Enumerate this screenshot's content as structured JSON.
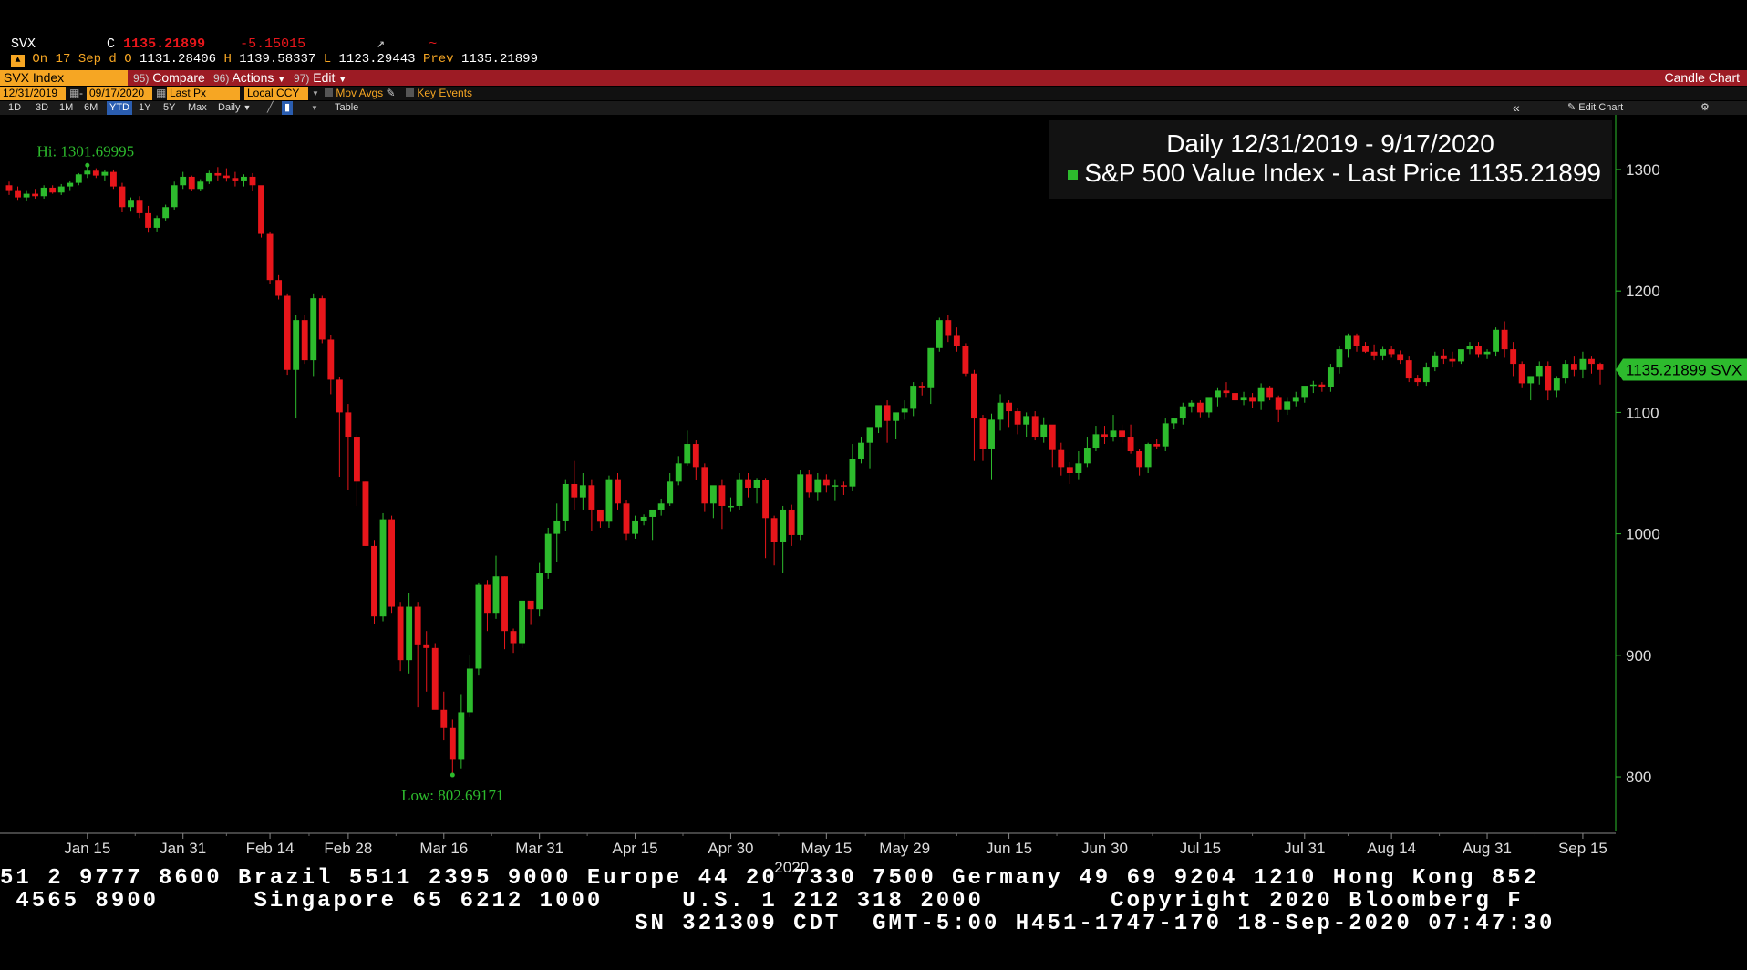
{
  "header": {
    "symbol": "SVX",
    "close_label": "C",
    "close_value": "1135.21899",
    "change": "-5.15015",
    "on_label": "On 17 Sep d",
    "open_label": "O",
    "open_value": "1131.28406",
    "high_label": "H",
    "high_value": "1139.58337",
    "low_label": "L",
    "low_value": "1123.29443",
    "prev_label": "Prev",
    "prev_value": "1135.21899"
  },
  "toolbar": {
    "security": "SVX Index",
    "compare_num": "95)",
    "compare": "Compare",
    "actions_num": "96)",
    "actions": "Actions",
    "edit_num": "97)",
    "edit": "Edit",
    "chart_type": "Candle Chart"
  },
  "options": {
    "start_date": "12/31/2019",
    "end_date": "09/17/2020",
    "field": "Last Px",
    "currency": "Local CCY",
    "mov_avgs": "Mov Avgs",
    "key_events": "Key Events"
  },
  "timeframes": [
    "1D",
    "3D",
    "1M",
    "6M",
    "YTD",
    "1Y",
    "5Y",
    "Max"
  ],
  "timeframe_selected": "YTD",
  "period": "Daily",
  "table_label": "Table",
  "edit_chart_label": "Edit Chart",
  "colors": {
    "up": "#2dbb2d",
    "down": "#e8161b",
    "accent": "#f6a623",
    "bar": "#9c1b24"
  },
  "chart_data": {
    "type": "candlestick",
    "title": "Daily 12/31/2019 - 9/17/2020",
    "series_name": "S&P 500 Value Index - Last Price",
    "last_price": "1135.21899",
    "last_price_tag": "1135.21899 SVX",
    "hi_label": "Hi: 1301.69995",
    "low_label": "Low: 802.69171",
    "ylim": [
      755,
      1345
    ],
    "y_ticks": [
      800,
      900,
      1000,
      1100,
      1200,
      1300
    ],
    "x_tick_labels": [
      "Jan 15",
      "Jan 31",
      "Feb 14",
      "Feb 28",
      "Mar 16",
      "Mar 31",
      "Apr 15",
      "Apr 30",
      "May 15",
      "May 29",
      "Jun 15",
      "Jun 30",
      "Jul 15",
      "Jul 31",
      "Aug 14",
      "Aug 31",
      "Sep 15"
    ],
    "x_tick_index": [
      9,
      20,
      30,
      39,
      50,
      61,
      72,
      83,
      94,
      103,
      115,
      126,
      137,
      149,
      159,
      170,
      181
    ],
    "year_label": "2020",
    "year_index": 90,
    "candles": [
      [
        1287,
        1290,
        1279,
        1283
      ],
      [
        1283,
        1286,
        1275,
        1277
      ],
      [
        1277,
        1283,
        1274,
        1280
      ],
      [
        1280,
        1284,
        1276,
        1278
      ],
      [
        1278,
        1287,
        1276,
        1285
      ],
      [
        1285,
        1287,
        1280,
        1281
      ],
      [
        1281,
        1288,
        1279,
        1286
      ],
      [
        1286,
        1291,
        1283,
        1289
      ],
      [
        1289,
        1297,
        1287,
        1296
      ],
      [
        1296,
        1302,
        1293,
        1299
      ],
      [
        1299,
        1301,
        1293,
        1295
      ],
      [
        1295,
        1300,
        1291,
        1298
      ],
      [
        1298,
        1300,
        1284,
        1286
      ],
      [
        1286,
        1289,
        1265,
        1269
      ],
      [
        1269,
        1277,
        1266,
        1275
      ],
      [
        1275,
        1278,
        1260,
        1264
      ],
      [
        1264,
        1270,
        1248,
        1252
      ],
      [
        1252,
        1262,
        1249,
        1260
      ],
      [
        1260,
        1271,
        1258,
        1269
      ],
      [
        1269,
        1290,
        1267,
        1287
      ],
      [
        1287,
        1298,
        1284,
        1294
      ],
      [
        1294,
        1295,
        1282,
        1284
      ],
      [
        1284,
        1292,
        1282,
        1290
      ],
      [
        1290,
        1299,
        1288,
        1297
      ],
      [
        1297,
        1302,
        1291,
        1295
      ],
      [
        1295,
        1301,
        1290,
        1293
      ],
      [
        1293,
        1298,
        1286,
        1291
      ],
      [
        1291,
        1296,
        1286,
        1294
      ],
      [
        1294,
        1297,
        1282,
        1287
      ],
      [
        1287,
        1285,
        1244,
        1247
      ],
      [
        1247,
        1249,
        1206,
        1209
      ],
      [
        1209,
        1213,
        1193,
        1196
      ],
      [
        1196,
        1198,
        1131,
        1135
      ],
      [
        1135,
        1180,
        1095,
        1176
      ],
      [
        1176,
        1180,
        1140,
        1143
      ],
      [
        1143,
        1198,
        1130,
        1194
      ],
      [
        1194,
        1196,
        1157,
        1160
      ],
      [
        1160,
        1164,
        1115,
        1127
      ],
      [
        1127,
        1129,
        1047,
        1100
      ],
      [
        1100,
        1107,
        1036,
        1080
      ],
      [
        1080,
        1082,
        1023,
        1043
      ],
      [
        1043,
        1043,
        990,
        990
      ],
      [
        990,
        995,
        926,
        932
      ],
      [
        932,
        1017,
        928,
        1012
      ],
      [
        1012,
        1015,
        935,
        940
      ],
      [
        940,
        944,
        887,
        896
      ],
      [
        896,
        951,
        885,
        940
      ],
      [
        940,
        944,
        857,
        909
      ],
      [
        909,
        920,
        870,
        906
      ],
      [
        906,
        910,
        860,
        855
      ],
      [
        855,
        870,
        830,
        840
      ],
      [
        840,
        847,
        803,
        814
      ],
      [
        814,
        868,
        807,
        853
      ],
      [
        853,
        900,
        849,
        889
      ],
      [
        889,
        960,
        884,
        958
      ],
      [
        958,
        962,
        920,
        935
      ],
      [
        935,
        982,
        930,
        965
      ],
      [
        965,
        965,
        905,
        920
      ],
      [
        920,
        922,
        902,
        910
      ],
      [
        910,
        942,
        906,
        945
      ],
      [
        945,
        940,
        925,
        938
      ],
      [
        938,
        976,
        932,
        968
      ],
      [
        968,
        1005,
        963,
        1000
      ],
      [
        1000,
        1025,
        977,
        1011
      ],
      [
        1011,
        1045,
        1002,
        1041
      ],
      [
        1041,
        1060,
        1020,
        1030
      ],
      [
        1030,
        1050,
        1020,
        1040
      ],
      [
        1040,
        1045,
        1002,
        1020
      ],
      [
        1020,
        1013,
        1005,
        1010
      ],
      [
        1010,
        1048,
        1005,
        1045
      ],
      [
        1045,
        1050,
        1020,
        1025
      ],
      [
        1025,
        1028,
        995,
        1000
      ],
      [
        1000,
        1015,
        996,
        1011
      ],
      [
        1011,
        1016,
        1007,
        1014
      ],
      [
        1014,
        1018,
        995,
        1020
      ],
      [
        1020,
        1029,
        1015,
        1025
      ],
      [
        1025,
        1050,
        1023,
        1043
      ],
      [
        1043,
        1064,
        1040,
        1058
      ],
      [
        1058,
        1085,
        1056,
        1074
      ],
      [
        1074,
        1077,
        1044,
        1055
      ],
      [
        1055,
        1058,
        1018,
        1025
      ],
      [
        1025,
        1030,
        1013,
        1040
      ],
      [
        1040,
        1045,
        1004,
        1023
      ],
      [
        1023,
        1030,
        1018,
        1023
      ],
      [
        1023,
        1050,
        1020,
        1045
      ],
      [
        1045,
        1050,
        1030,
        1038
      ],
      [
        1038,
        1046,
        1025,
        1044
      ],
      [
        1044,
        1046,
        980,
        1013
      ],
      [
        1013,
        1015,
        974,
        993
      ],
      [
        993,
        1023,
        968,
        1020
      ],
      [
        1020,
        1024,
        990,
        999
      ],
      [
        999,
        1053,
        995,
        1049
      ],
      [
        1049,
        1053,
        1030,
        1034
      ],
      [
        1034,
        1050,
        1027,
        1045
      ],
      [
        1045,
        1049,
        1034,
        1040
      ],
      [
        1040,
        1045,
        1027,
        1040
      ],
      [
        1040,
        1043,
        1032,
        1039
      ],
      [
        1039,
        1074,
        1035,
        1062
      ],
      [
        1062,
        1080,
        1058,
        1075
      ],
      [
        1075,
        1080,
        1054,
        1088
      ],
      [
        1088,
        1105,
        1083,
        1106
      ],
      [
        1106,
        1110,
        1075,
        1093
      ],
      [
        1093,
        1096,
        1078,
        1100
      ],
      [
        1100,
        1110,
        1094,
        1103
      ],
      [
        1103,
        1125,
        1097,
        1122
      ],
      [
        1122,
        1125,
        1114,
        1120
      ],
      [
        1120,
        1127,
        1107,
        1153
      ],
      [
        1153,
        1178,
        1150,
        1176
      ],
      [
        1176,
        1180,
        1158,
        1163
      ],
      [
        1163,
        1170,
        1150,
        1155
      ],
      [
        1155,
        1157,
        1130,
        1132
      ],
      [
        1132,
        1135,
        1060,
        1095
      ],
      [
        1095,
        1098,
        1060,
        1070
      ],
      [
        1070,
        1099,
        1045,
        1094
      ],
      [
        1094,
        1115,
        1085,
        1108
      ],
      [
        1108,
        1110,
        1088,
        1101
      ],
      [
        1101,
        1104,
        1082,
        1090
      ],
      [
        1090,
        1100,
        1080,
        1097
      ],
      [
        1097,
        1101,
        1077,
        1080
      ],
      [
        1080,
        1096,
        1075,
        1090
      ],
      [
        1090,
        1088,
        1055,
        1069
      ],
      [
        1069,
        1075,
        1048,
        1055
      ],
      [
        1055,
        1059,
        1041,
        1050
      ],
      [
        1050,
        1068,
        1045,
        1058
      ],
      [
        1058,
        1080,
        1055,
        1071
      ],
      [
        1071,
        1089,
        1068,
        1082
      ],
      [
        1082,
        1089,
        1074,
        1080
      ],
      [
        1080,
        1098,
        1076,
        1085
      ],
      [
        1085,
        1090,
        1075,
        1080
      ],
      [
        1080,
        1090,
        1066,
        1068
      ],
      [
        1068,
        1070,
        1048,
        1055
      ],
      [
        1055,
        1075,
        1050,
        1074
      ],
      [
        1074,
        1078,
        1070,
        1072
      ],
      [
        1072,
        1095,
        1068,
        1091
      ],
      [
        1091,
        1095,
        1086,
        1095
      ],
      [
        1095,
        1108,
        1090,
        1105
      ],
      [
        1105,
        1110,
        1100,
        1108
      ],
      [
        1108,
        1110,
        1096,
        1100
      ],
      [
        1100,
        1108,
        1096,
        1112
      ],
      [
        1112,
        1120,
        1105,
        1118
      ],
      [
        1118,
        1125,
        1112,
        1116
      ],
      [
        1116,
        1119,
        1107,
        1110
      ],
      [
        1110,
        1117,
        1106,
        1112
      ],
      [
        1112,
        1116,
        1104,
        1109
      ],
      [
        1109,
        1124,
        1102,
        1120
      ],
      [
        1120,
        1122,
        1110,
        1112
      ],
      [
        1112,
        1114,
        1092,
        1102
      ],
      [
        1102,
        1112,
        1098,
        1109
      ],
      [
        1109,
        1117,
        1105,
        1112
      ],
      [
        1112,
        1120,
        1108,
        1122
      ],
      [
        1122,
        1126,
        1116,
        1123
      ],
      [
        1123,
        1125,
        1117,
        1121
      ],
      [
        1121,
        1140,
        1117,
        1137
      ],
      [
        1137,
        1155,
        1132,
        1152
      ],
      [
        1152,
        1165,
        1145,
        1163
      ],
      [
        1163,
        1165,
        1150,
        1155
      ],
      [
        1155,
        1158,
        1149,
        1150
      ],
      [
        1150,
        1156,
        1143,
        1147
      ],
      [
        1147,
        1154,
        1143,
        1152
      ],
      [
        1152,
        1155,
        1145,
        1148
      ],
      [
        1148,
        1151,
        1140,
        1143
      ],
      [
        1143,
        1146,
        1125,
        1128
      ],
      [
        1128,
        1131,
        1122,
        1125
      ],
      [
        1125,
        1141,
        1122,
        1137
      ],
      [
        1137,
        1150,
        1134,
        1147
      ],
      [
        1147,
        1152,
        1140,
        1144
      ],
      [
        1144,
        1150,
        1137,
        1142
      ],
      [
        1142,
        1150,
        1140,
        1152
      ],
      [
        1152,
        1158,
        1148,
        1155
      ],
      [
        1155,
        1158,
        1145,
        1148
      ],
      [
        1148,
        1152,
        1144,
        1150
      ],
      [
        1150,
        1170,
        1146,
        1168
      ],
      [
        1168,
        1175,
        1145,
        1152
      ],
      [
        1152,
        1158,
        1130,
        1140
      ],
      [
        1140,
        1142,
        1120,
        1124
      ],
      [
        1124,
        1128,
        1110,
        1130
      ],
      [
        1130,
        1142,
        1123,
        1138
      ],
      [
        1138,
        1142,
        1110,
        1118
      ],
      [
        1118,
        1130,
        1112,
        1128
      ],
      [
        1128,
        1143,
        1124,
        1140
      ],
      [
        1140,
        1146,
        1130,
        1135
      ],
      [
        1135,
        1150,
        1128,
        1144
      ],
      [
        1144,
        1146,
        1132,
        1140
      ],
      [
        1140,
        1141,
        1123,
        1135
      ]
    ]
  },
  "ticker": {
    "line1": "51 2 9777 8600 Brazil 5511 2395 9000 Europe 44 20 7330 7500 Germany 49 69 9204 1210 Hong Kong 852",
    "line2": " 4565 8900      Singapore 65 6212 1000     U.S. 1 212 318 2000        Copyright 2020 Bloomberg F",
    "line3": "                                        SN 321309 CDT  GMT-5:00 H451-1747-170 18-Sep-2020 07:47:30"
  }
}
